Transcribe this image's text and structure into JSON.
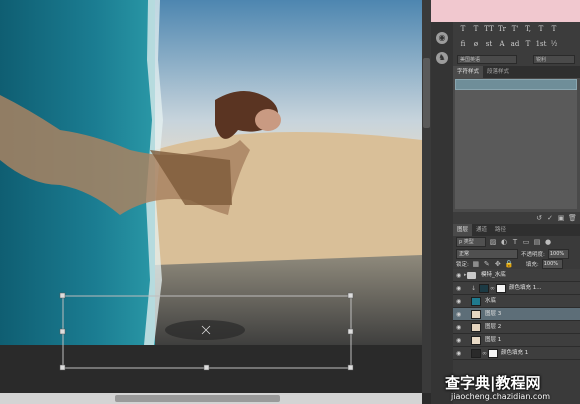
{
  "text_panel": {
    "type_buttons": [
      "T",
      "T",
      "TT",
      "Tr",
      "T'",
      "T,",
      "T",
      "T"
    ],
    "ot_buttons": [
      "fi",
      "ø",
      "st",
      "A",
      "ad",
      "T",
      "1st",
      "½"
    ],
    "language": "美国英语",
    "antialias": "锐利"
  },
  "style_panel": {
    "tabs": [
      "字符样式",
      "段落样式"
    ],
    "active_tab": 0
  },
  "layers_panel": {
    "tabs": [
      "图层",
      "通道",
      "路径"
    ],
    "filter": "p 类型",
    "blend_mode": "正常",
    "opacity_label": "不透明度:",
    "opacity_value": "100%",
    "lock_label": "锁定:",
    "fill_label": "填充:",
    "fill_value": "100%",
    "layers": [
      {
        "name": "模特_水底",
        "kind": "group",
        "selected": false
      },
      {
        "name": "颜色填充 1...",
        "kind": "fill",
        "selected": false
      },
      {
        "name": "水底",
        "kind": "pixel",
        "selected": false
      },
      {
        "name": "图层 3",
        "kind": "pixel",
        "selected": true
      },
      {
        "name": "图层 2",
        "kind": "pixel",
        "selected": false
      },
      {
        "name": "图层 1",
        "kind": "pixel",
        "selected": false
      },
      {
        "name": "颜色填充 1",
        "kind": "fill",
        "selected": false
      }
    ]
  },
  "watermark": {
    "brand": "查字典|教程网",
    "url": "jiaocheng.chazidian.com"
  },
  "colors": {
    "canvas_water": "#1a6f83",
    "panel_bg": "#3c3c3c",
    "selected_layer": "#5d6e78",
    "top_highlight": "#f1c8cf"
  }
}
